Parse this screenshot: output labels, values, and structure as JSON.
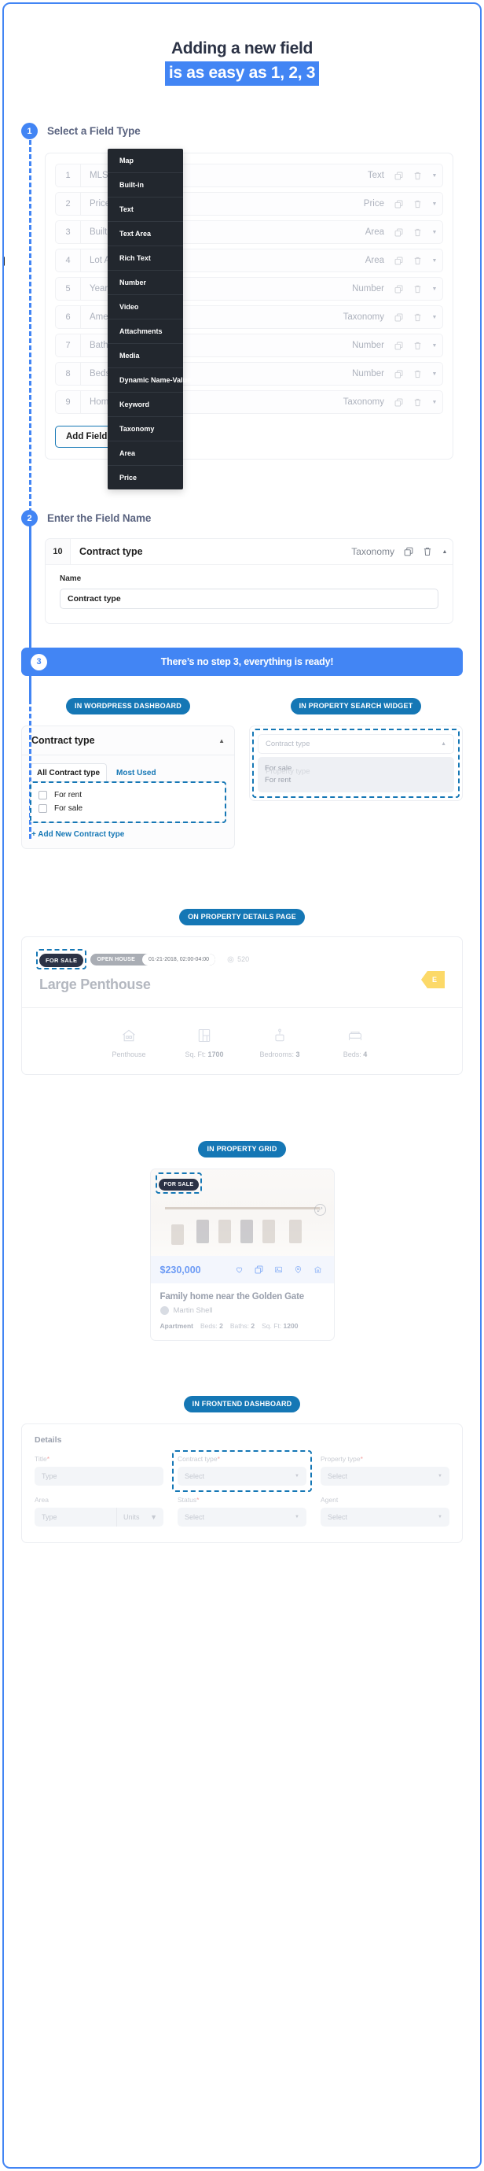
{
  "header": {
    "title_line1": "Adding a new field",
    "title_line2": "is as easy as 1, 2, 3"
  },
  "step1": {
    "badge": "1",
    "title": "Select a Field Type",
    "rows": [
      {
        "num": "1",
        "name": "MLS/Source ID",
        "type": "Text"
      },
      {
        "num": "2",
        "name": "Price",
        "type": "Price"
      },
      {
        "num": "3",
        "name": "Built-up Area",
        "type": "Area"
      },
      {
        "num": "4",
        "name": "Lot Area",
        "type": "Area"
      },
      {
        "num": "5",
        "name": "Year Built",
        "type": "Number"
      },
      {
        "num": "6",
        "name": "Amenities",
        "type": "Taxonomy"
      },
      {
        "num": "7",
        "name": "Baths",
        "type": "Number"
      },
      {
        "num": "8",
        "name": "Beds",
        "type": "Number"
      },
      {
        "num": "9",
        "name": "Home type",
        "type": "Taxonomy"
      }
    ],
    "add_field_label": "Add Field",
    "dropdown_options": [
      "Map",
      "Built-in",
      "Text",
      "Text Area",
      "Rich Text",
      "Number",
      "Video",
      "Attachments",
      "Media",
      "Dynamic Name-Value",
      "Keyword",
      "Taxonomy",
      "Area",
      "Price"
    ]
  },
  "step2": {
    "badge": "2",
    "title": "Enter the Field Name",
    "row": {
      "num": "10",
      "name": "Contract type",
      "type": "Taxonomy"
    },
    "name_label": "Name",
    "name_value": "Contract type"
  },
  "step3": {
    "badge": "3",
    "text": "There’s no step 3, everything is ready!"
  },
  "wordpress": {
    "pill": "IN WORDPRESS DASHBOARD",
    "panel_title": "Contract type",
    "tab_all": "All Contract type",
    "tab_most_used": "Most Used",
    "terms": [
      "For rent",
      "For sale"
    ],
    "add_link": "+ Add New Contract type"
  },
  "widget": {
    "pill": "IN PROPERTY SEARCH WIDGET",
    "select_placeholder": "Contract type",
    "ghost_label": "Property type",
    "options": [
      "For sale",
      "For rent"
    ]
  },
  "details": {
    "pill": "ON PROPERTY DETAILS PAGE",
    "badge_sale": "FOR SALE",
    "badge_openhouse_label": "OPEN HOUSE",
    "badge_openhouse_value": "01-21-2018, 02:00-04:00",
    "views": "520",
    "title": "Large Penthouse",
    "flag": "E",
    "stats": [
      {
        "icon": "house-icon",
        "label": "Penthouse",
        "value": ""
      },
      {
        "icon": "floorplan-icon",
        "label": "Sq. Ft:",
        "value": "1700"
      },
      {
        "icon": "bedroom-icon",
        "label": "Bedrooms:",
        "value": "3"
      },
      {
        "icon": "bed-icon",
        "label": "Beds:",
        "value": "4"
      }
    ]
  },
  "grid": {
    "pill": "IN PROPERTY GRID",
    "badge": "FOR SALE",
    "price": "$230,000",
    "title": "Family home near the Golden Gate",
    "agent": "Martin Shell",
    "meta": [
      {
        "key": "Apartment",
        "label": "",
        "value": ""
      },
      {
        "key": "",
        "label": "Beds:",
        "value": "2"
      },
      {
        "key": "",
        "label": "Baths:",
        "value": "2"
      },
      {
        "key": "",
        "label": "Sq. Ft:",
        "value": "1200"
      }
    ],
    "icons": [
      "heart-icon",
      "compare-icon",
      "gallery-icon",
      "map-pin-icon",
      "floorplan-icon"
    ]
  },
  "frontend": {
    "pill": "IN FRONTEND DASHBOARD",
    "section_title": "Details",
    "fields_row1": [
      {
        "label": "Title",
        "required": true,
        "value": "Type",
        "control": "input"
      },
      {
        "label": "Contract type",
        "required": true,
        "value": "Select",
        "control": "select"
      },
      {
        "label": "Property type",
        "required": true,
        "value": "Select",
        "control": "select"
      }
    ],
    "fields_row2": [
      {
        "label": "Area",
        "required": false,
        "value": "Type",
        "units": "Units",
        "control": "split"
      },
      {
        "label": "Status",
        "required": true,
        "value": "Select",
        "control": "select"
      },
      {
        "label": "Agent",
        "required": false,
        "value": "Select",
        "control": "select"
      }
    ]
  },
  "colors": {
    "accent_blue": "#4285f4",
    "pill_blue": "#1577b5",
    "dark": "#2b3245",
    "dropdown_bg": "#22272e"
  }
}
